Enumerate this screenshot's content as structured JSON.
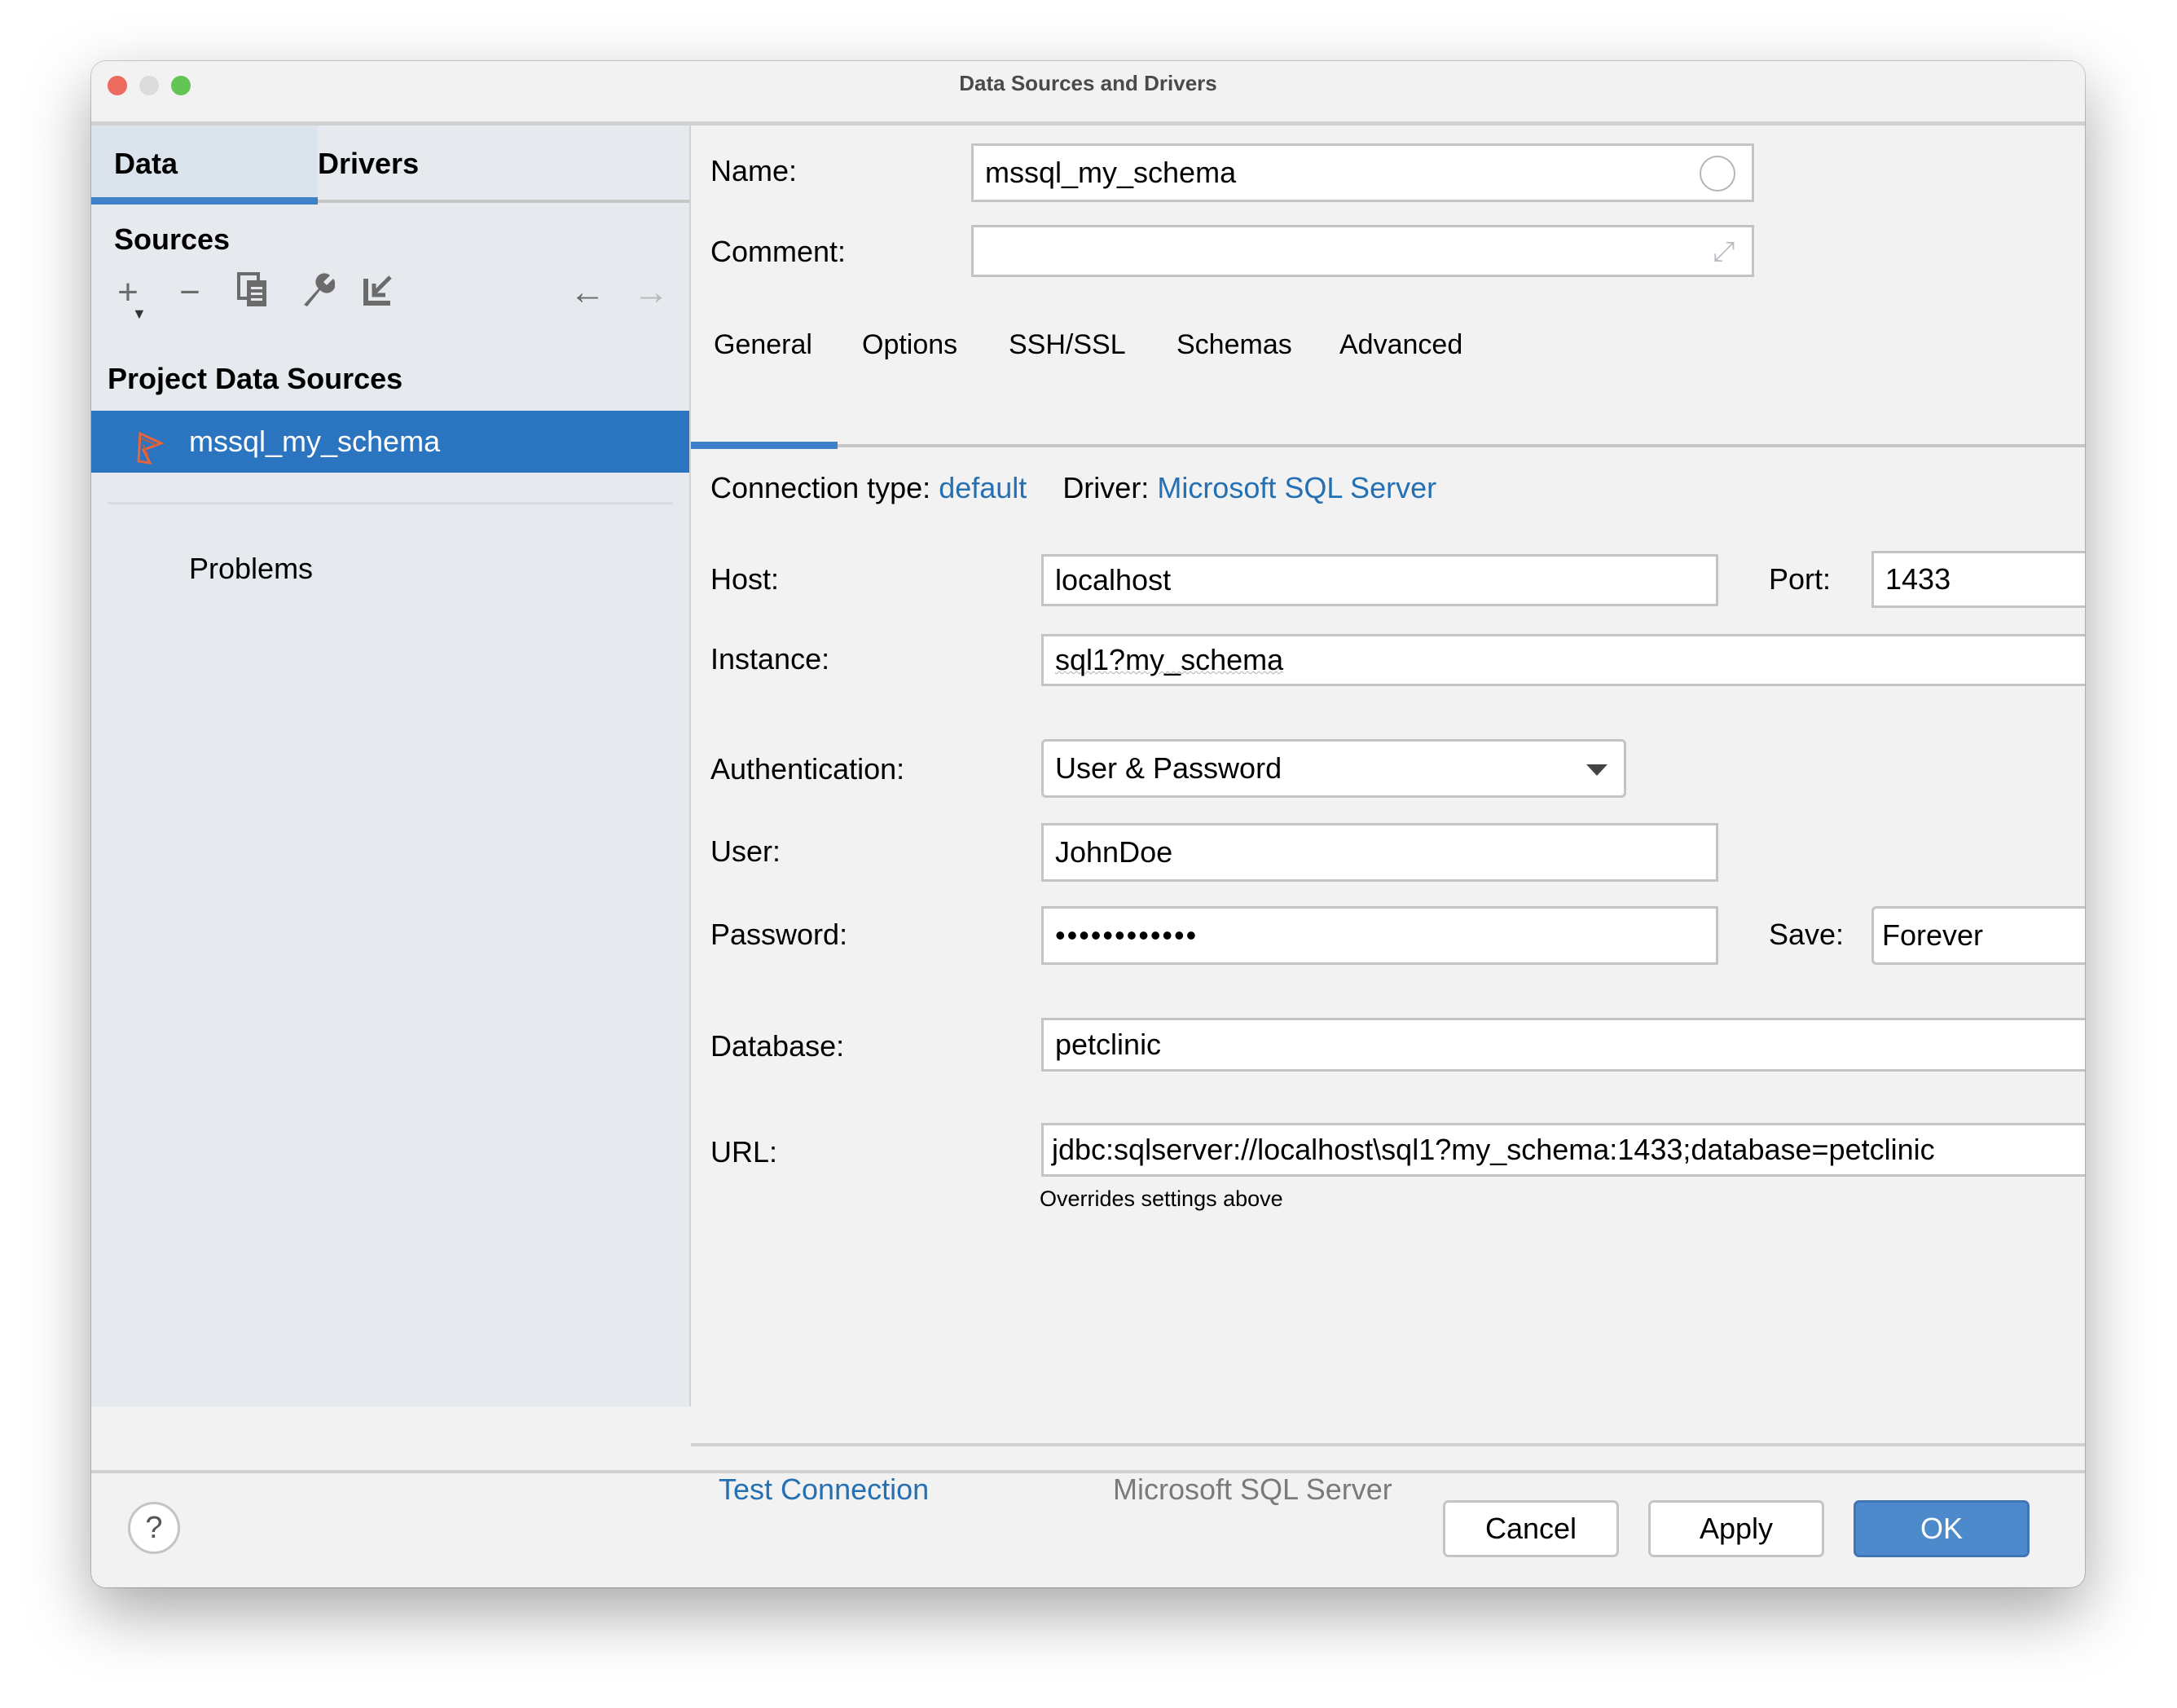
{
  "window": {
    "title": "Data Sources and Drivers",
    "traffic_lights": {
      "close": "#ec6a5e",
      "minimize": "#dcdcdc",
      "zoom": "#62c554"
    }
  },
  "left_panel": {
    "tabs": [
      {
        "label": "Data Sources",
        "active": true
      },
      {
        "label": "Drivers",
        "active": false
      }
    ],
    "toolbar": {
      "add_icon": "+",
      "remove_icon": "−",
      "duplicate_icon": "⧉",
      "properties_icon": "wrench",
      "import_icon": "↙",
      "back_icon": "←",
      "forward_icon": "→"
    },
    "section_title": "Project Data Sources",
    "items": [
      {
        "label": "mssql_my_schema",
        "icon": "mssql-icon",
        "selected": true
      }
    ],
    "problems_label": "Problems"
  },
  "form": {
    "name_label": "Name:",
    "name_value": "mssql_my_schema",
    "comment_label": "Comment:",
    "comment_value": "",
    "tabs": [
      {
        "label": "General",
        "active": true
      },
      {
        "label": "Options",
        "active": false
      },
      {
        "label": "SSH/SSL",
        "active": false
      },
      {
        "label": "Schemas",
        "active": false
      },
      {
        "label": "Advanced",
        "active": false
      }
    ],
    "connection_type_label": "Connection type:",
    "connection_type_value": "default",
    "driver_label": "Driver:",
    "driver_value": "Microsoft SQL Server",
    "host_label": "Host:",
    "host_value": "localhost",
    "port_label": "Port:",
    "port_value": "1433",
    "instance_label": "Instance:",
    "instance_value": "sql1?my_schema",
    "auth_label": "Authentication:",
    "auth_value": "User & Password",
    "user_label": "User:",
    "user_value": "JohnDoe",
    "password_label": "Password:",
    "password_value": "••••••••••••",
    "save_label": "Save:",
    "save_value": "Forever",
    "database_label": "Database:",
    "database_value": "petclinic",
    "url_label": "URL:",
    "url_value": "jdbc:sqlserver://localhost\\sql1?my_schema:1433;database=petclinic",
    "url_hint": "Overrides settings above"
  },
  "bottom_bar": {
    "test_connection": "Test Connection",
    "driver_name": "Microsoft SQL Server",
    "revert_icon": "↶"
  },
  "footer": {
    "help_label": "?",
    "cancel": "Cancel",
    "apply": "Apply",
    "ok": "OK"
  },
  "colors": {
    "accent": "#2a74c0",
    "link": "#2470b3",
    "primary_button": "#4d8acb"
  }
}
